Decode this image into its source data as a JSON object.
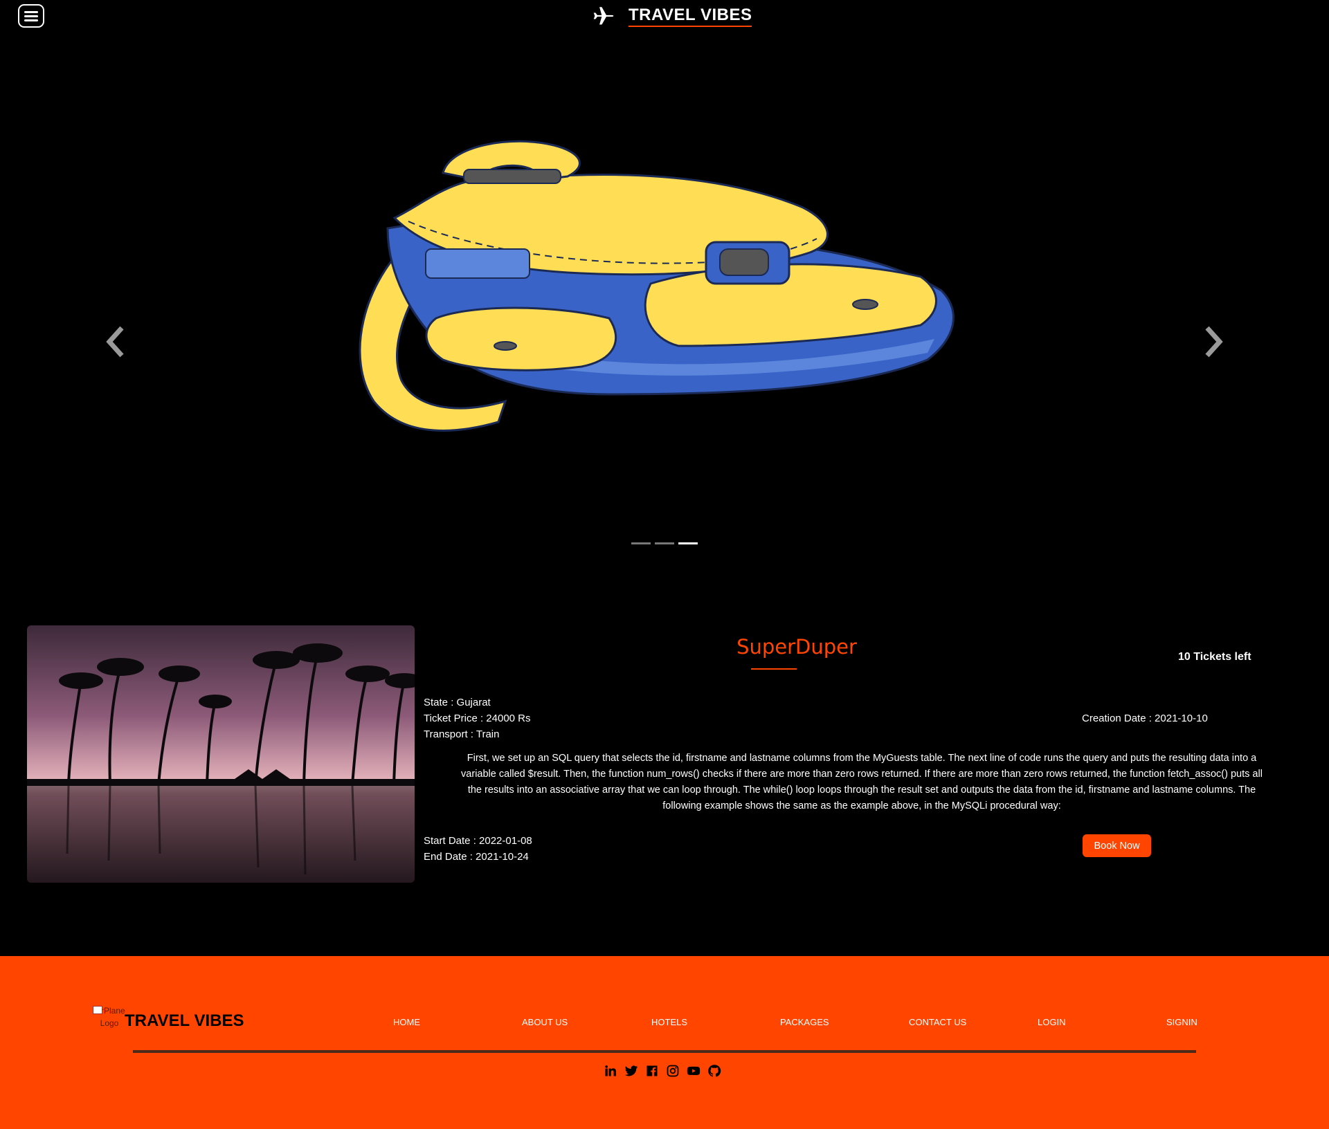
{
  "header": {
    "brand_name": "TRAVEL VIBES",
    "menu_icon": "hamburger-menu-icon",
    "logo_icon": "airplane-icon"
  },
  "carousel": {
    "slide_image": "backpack-illustration",
    "prev_icon": "chevron-left-icon",
    "next_icon": "chevron-right-icon",
    "slide_count": 3,
    "active_slide": 3
  },
  "package": {
    "image": "palm-trees-sunset-photo",
    "title": "SuperDuper",
    "tickets_left": "10 Tickets left",
    "state": "State : Gujarat",
    "ticket_price": "Ticket Price : 24000 Rs",
    "transport": "Transport : Train",
    "creation_date": "Creation Date : 2021-10-10",
    "description": "First, we set up an SQL query that selects the id, firstname and lastname columns from the MyGuests table. The next line of code runs the query and puts the resulting data into a variable called $result. Then, the function num_rows() checks if there are more than zero rows returned. If there are more than zero rows returned, the function fetch_assoc() puts all the results into an associative array that we can loop through. The while() loop loops through the result set and outputs the data from the id, firstname and lastname columns. The following example shows the same as the example above, in the MySQLi procedural way:",
    "start_date": "Start Date : 2022-01-08",
    "end_date": "End Date : 2021-10-24",
    "book_label": "Book Now"
  },
  "footer": {
    "logo_alt": "AirPlane Logo",
    "brand_name": "TRAVEL VIBES",
    "nav": [
      "HOME",
      "ABOUT US",
      "HOTELS",
      "PACKAGES",
      "CONTACT US",
      "LOGIN",
      "SIGNIN"
    ],
    "socials": [
      "linkedin-icon",
      "twitter-icon",
      "facebook-icon",
      "instagram-icon",
      "youtube-icon",
      "github-icon"
    ]
  },
  "colors": {
    "accent": "#ff4500",
    "background": "#000000",
    "backpack_yellow": "#ffdd55",
    "backpack_blue": "#3a63c7"
  }
}
